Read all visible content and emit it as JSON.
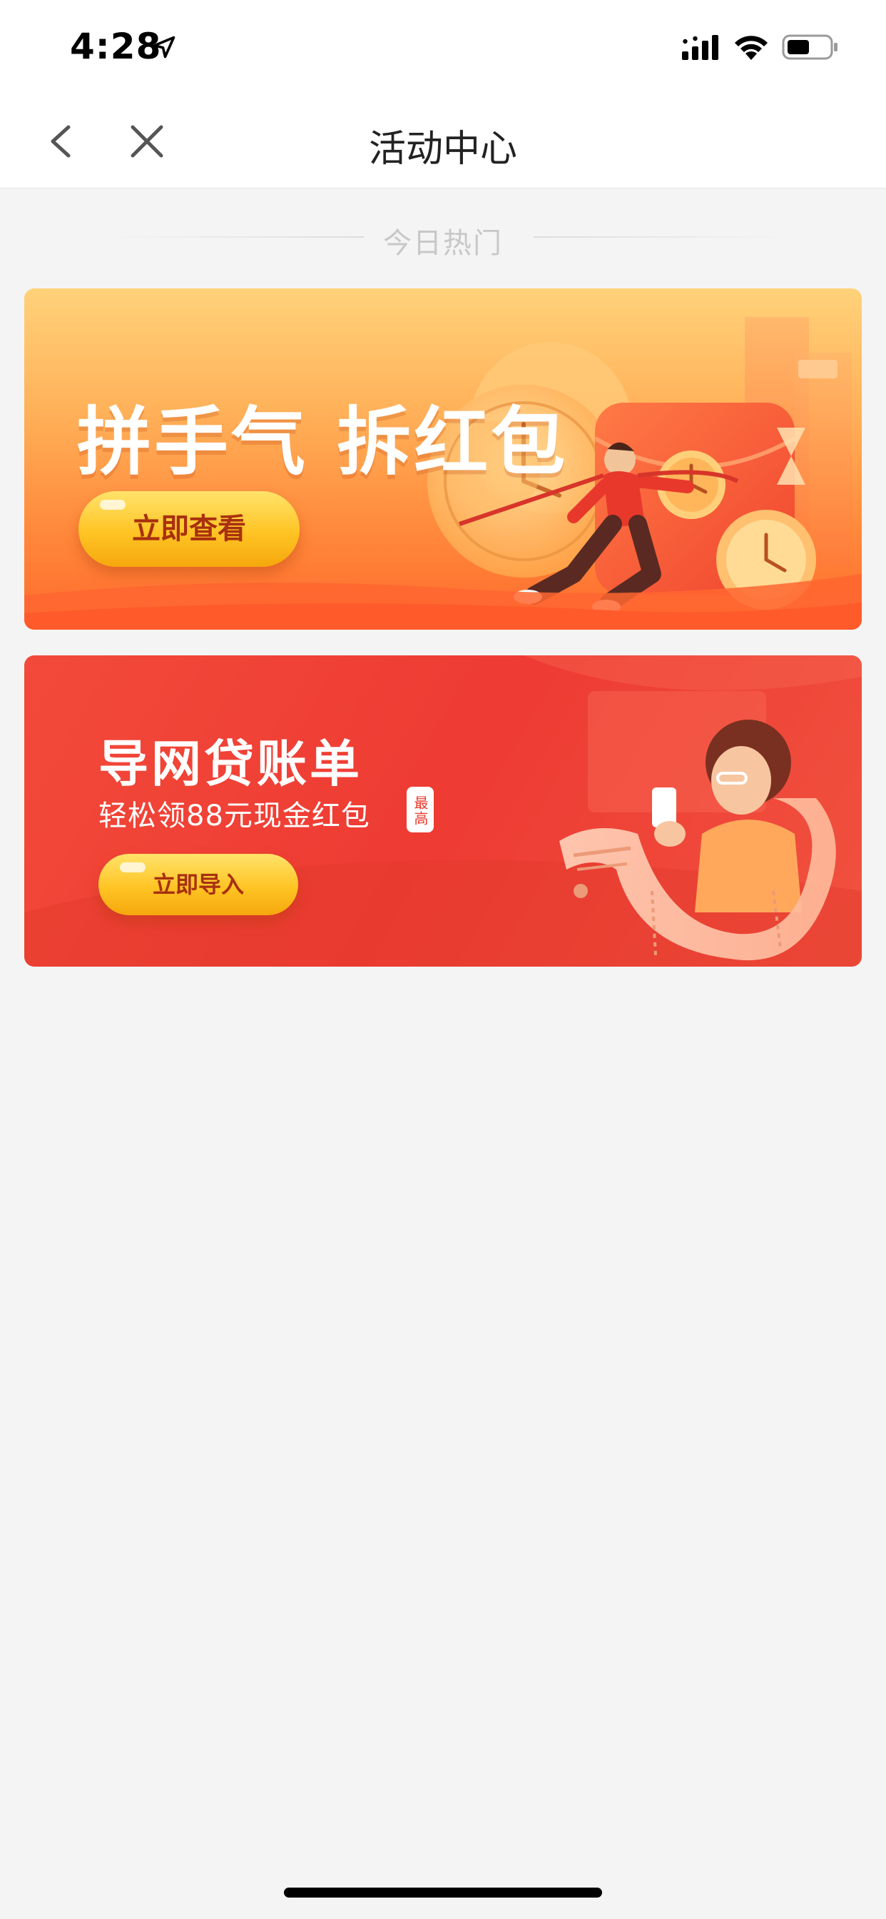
{
  "status_bar": {
    "time": "4:28",
    "icons": [
      "location-arrow-icon",
      "cellular-signal-icon",
      "wifi-icon",
      "battery-icon"
    ]
  },
  "nav": {
    "title": "活动中心",
    "back_icon": "chevron-left-icon",
    "close_icon": "close-icon"
  },
  "section": {
    "title": "今日热门"
  },
  "banners": [
    {
      "title": "拼手气 拆红包",
      "button_label": "立即查看"
    },
    {
      "title": "导网贷账单",
      "subtitle": "轻松领88元现金红包",
      "badge": "最高",
      "button_label": "立即导入"
    }
  ],
  "colors": {
    "banner_1_bg": "#ff8a3c",
    "banner_2_bg": "#ee3b33",
    "cta_button": "#ffc424",
    "cta_text": "#a8300f"
  }
}
